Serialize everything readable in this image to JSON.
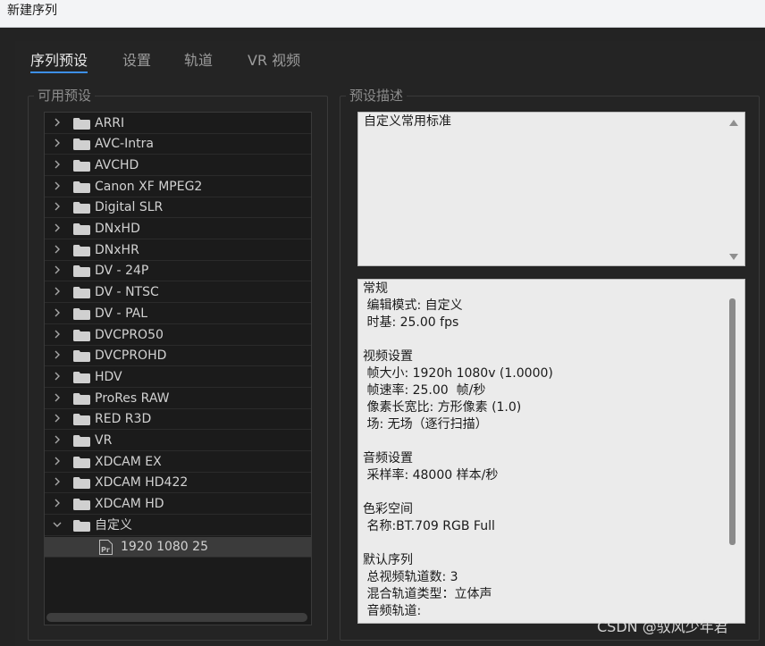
{
  "window": {
    "title": "新建序列"
  },
  "tabs": [
    {
      "label": "序列预设",
      "active": true
    },
    {
      "label": "设置",
      "active": false
    },
    {
      "label": "轨道",
      "active": false
    },
    {
      "label": "VR 视频",
      "active": false
    }
  ],
  "presets": {
    "title": "可用预设",
    "folders": [
      "ARRI",
      "AVC-Intra",
      "AVCHD",
      "Canon XF MPEG2",
      "Digital SLR",
      "DNxHD",
      "DNxHR",
      "DV - 24P",
      "DV - NTSC",
      "DV - PAL",
      "DVCPRO50",
      "DVCPROHD",
      "HDV",
      "ProRes RAW",
      "RED R3D",
      "VR",
      "XDCAM EX",
      "XDCAM HD422",
      "XDCAM HD"
    ],
    "expanded_folder": "自定义",
    "selected_item": "1920 1080 25",
    "item_icon": "premiere-pr-icon"
  },
  "description": {
    "title": "预设描述",
    "text": "自定义常用标准"
  },
  "details": {
    "lines": [
      "常规",
      " 编辑模式: 自定义",
      " 时基: 25.00 fps",
      "",
      "视频设置",
      " 帧大小: 1920h 1080v (1.0000)",
      " 帧速率: 25.00  帧/秒",
      " 像素长宽比: 方形像素 (1.0)",
      " 场: 无场（逐行扫描）",
      "",
      "音频设置",
      " 采样率: 48000 样本/秒",
      "",
      "色彩空间",
      " 名称:BT.709 RGB Full",
      "",
      "默认序列",
      " 总视频轨道数: 3",
      " 混合轨道类型：立体声",
      " 音频轨道:"
    ]
  },
  "watermark": "CSDN @驭风少年君",
  "colors": {
    "accent": "#3d8fe6",
    "background": "#232323",
    "panel": "#1b1b1b",
    "selected_row": "#3b3b3b"
  }
}
